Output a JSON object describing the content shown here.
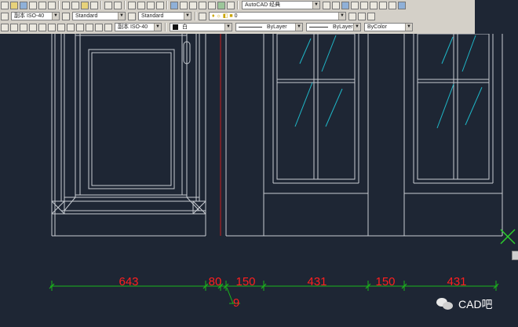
{
  "toolbar": {
    "workspace_label": "AutoCAD 经典",
    "text_style": "副本 ISO-40",
    "dim_style": "Standard",
    "table_style": "Standard",
    "mleader_style": "副本 ISO-40",
    "layer_name": "0",
    "layer_color_name": "白",
    "linetype": "ByLayer",
    "lineweight": "ByLayer",
    "plot_style": "ByColor"
  },
  "drawing": {
    "colors": {
      "background": "#1e2634",
      "linework": "#c8ccd2",
      "hatch": "#1fb7c8",
      "dimension_line": "#1bb51b",
      "dimension_text": "#ff1f1f",
      "red_line": "#c81e1e",
      "marker": "#2cd02c"
    },
    "dimensions": [
      {
        "name": "dim-643",
        "value": "643"
      },
      {
        "name": "dim-80",
        "value": "80"
      },
      {
        "name": "dim-150-left",
        "value": "150"
      },
      {
        "name": "dim-431-left",
        "value": "431"
      },
      {
        "name": "dim-150-right",
        "value": "150"
      },
      {
        "name": "dim-431-right",
        "value": "431"
      },
      {
        "name": "dim-9",
        "value": "9"
      }
    ]
  },
  "watermark": {
    "text": "CAD吧"
  },
  "icons": [
    "new-icon",
    "open-icon",
    "save-icon",
    "undo-icon",
    "redo-icon",
    "pan-icon",
    "zoom-icon",
    "layer-icon",
    "dim-linear-icon",
    "gear-icon"
  ]
}
